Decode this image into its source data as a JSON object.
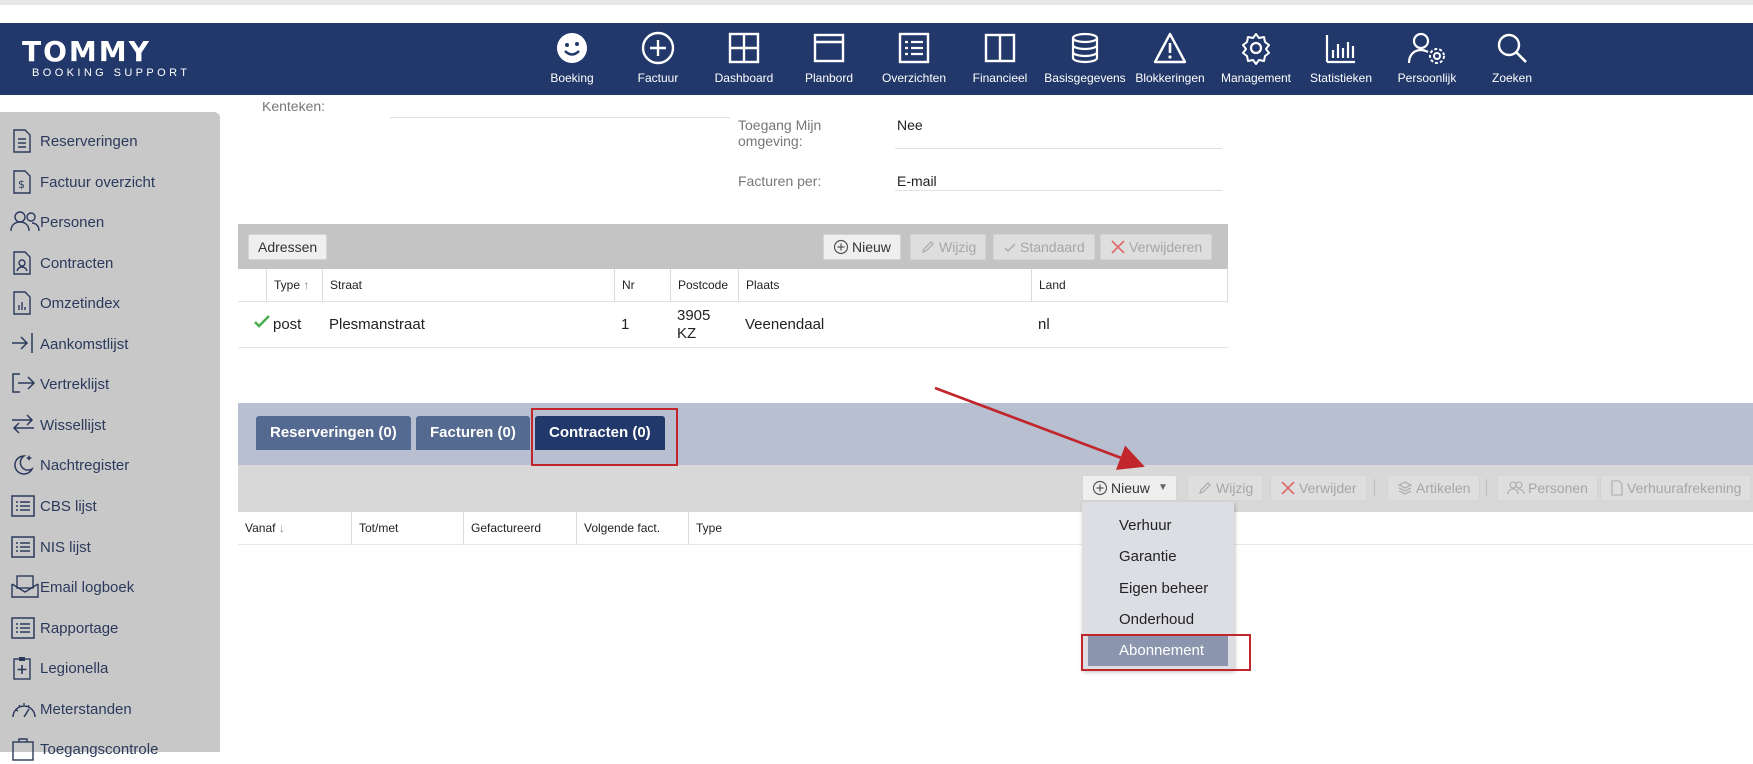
{
  "app": {
    "logo_main": "TOMMY",
    "logo_sub": "BOOKING SUPPORT"
  },
  "nav": [
    {
      "label": "Boeking",
      "icon": "smiley-icon"
    },
    {
      "label": "Factuur",
      "icon": "plus-circle-icon"
    },
    {
      "label": "Dashboard",
      "icon": "grid-icon"
    },
    {
      "label": "Planbord",
      "icon": "window-icon"
    },
    {
      "label": "Overzichten",
      "icon": "list-icon"
    },
    {
      "label": "Financieel",
      "icon": "book-icon"
    },
    {
      "label": "Basisgegevens",
      "icon": "database-icon"
    },
    {
      "label": "Blokkeringen",
      "icon": "warning-icon"
    },
    {
      "label": "Management",
      "icon": "gear-icon"
    },
    {
      "label": "Statistieken",
      "icon": "bar-chart-icon"
    },
    {
      "label": "Persoonlijk",
      "icon": "user-gear-icon"
    },
    {
      "label": "Zoeken",
      "icon": "search-icon"
    }
  ],
  "sidebar": [
    {
      "label": "Reserveringen"
    },
    {
      "label": "Factuur overzicht"
    },
    {
      "label": "Personen"
    },
    {
      "label": "Contracten"
    },
    {
      "label": "Omzetindex"
    },
    {
      "label": "Aankomstlijst"
    },
    {
      "label": "Vertreklijst"
    },
    {
      "label": "Wissellijst"
    },
    {
      "label": "Nachtregister"
    },
    {
      "label": "CBS lijst"
    },
    {
      "label": "NIS lijst"
    },
    {
      "label": "Email logboek"
    },
    {
      "label": "Rapportage"
    },
    {
      "label": "Legionella"
    },
    {
      "label": "Meterstanden"
    },
    {
      "label": "Toegangscontrole"
    }
  ],
  "fields": {
    "partial_label": "Kenteken:",
    "toegang_label": "Toegang Mijn omgeving:",
    "toegang_value": "Nee",
    "facturen_label": "Facturen per:",
    "facturen_value": "E-mail"
  },
  "addresses": {
    "tab_label": "Adressen",
    "buttons": {
      "new": "Nieuw",
      "edit": "Wijzig",
      "default": "Standaard",
      "delete": "Verwijderen"
    },
    "columns": [
      "Type",
      "Straat",
      "Nr",
      "Postcode",
      "Plaats",
      "Land"
    ],
    "rows": [
      {
        "type": "post",
        "street": "Plesmanstraat",
        "nr": "1",
        "postcode_1": "3905",
        "postcode_2": "KZ",
        "city": "Veenendaal",
        "country": "nl"
      }
    ]
  },
  "tabs": [
    {
      "label": "Reserveringen (0)"
    },
    {
      "label": "Facturen (0)"
    },
    {
      "label": "Contracten (0)"
    }
  ],
  "contracts": {
    "buttons": {
      "new": "Nieuw",
      "edit": "Wijzig",
      "delete": "Verwijder",
      "articles": "Artikelen",
      "persons": "Personen",
      "rental": "Verhuurafrekening"
    },
    "columns": [
      "Vanaf",
      "Tot/met",
      "Gefactureerd",
      "Volgende fact.",
      "Type"
    ]
  },
  "dropdown": {
    "items": [
      "Verhuur",
      "Garantie",
      "Eigen beheer",
      "Onderhoud",
      "Abonnement"
    ],
    "selected": "Abonnement"
  },
  "colors": {
    "header": "#22386a",
    "annotation": "#c0262c",
    "tab": "#556a90"
  }
}
